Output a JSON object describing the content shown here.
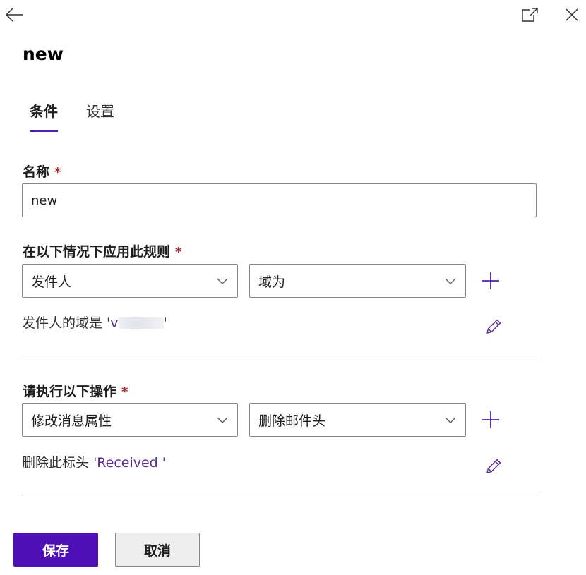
{
  "panel": {
    "title": "new"
  },
  "tabs": [
    {
      "label": "条件"
    },
    {
      "label": "设置"
    }
  ],
  "name_field": {
    "label": "名称",
    "required_mark": "*",
    "value": "new"
  },
  "condition_section": {
    "label": "在以下情况下应用此规则",
    "required_mark": "*",
    "dropdown1": "发件人",
    "dropdown2": "域为",
    "summary_text": "发件人的域是 '",
    "summary_value": "v",
    "summary_suffix": "'"
  },
  "action_section": {
    "label": "请执行以下操作",
    "required_mark": "*",
    "dropdown1": "修改消息属性",
    "dropdown2": "删除邮件头",
    "summary_text": "删除此标头",
    "summary_value": "'Received '"
  },
  "footer": {
    "save_label": "保存",
    "cancel_label": "取消"
  },
  "colors": {
    "accent": "#4f0fb6",
    "required": "#a4262c",
    "link": "#5c2e91"
  }
}
